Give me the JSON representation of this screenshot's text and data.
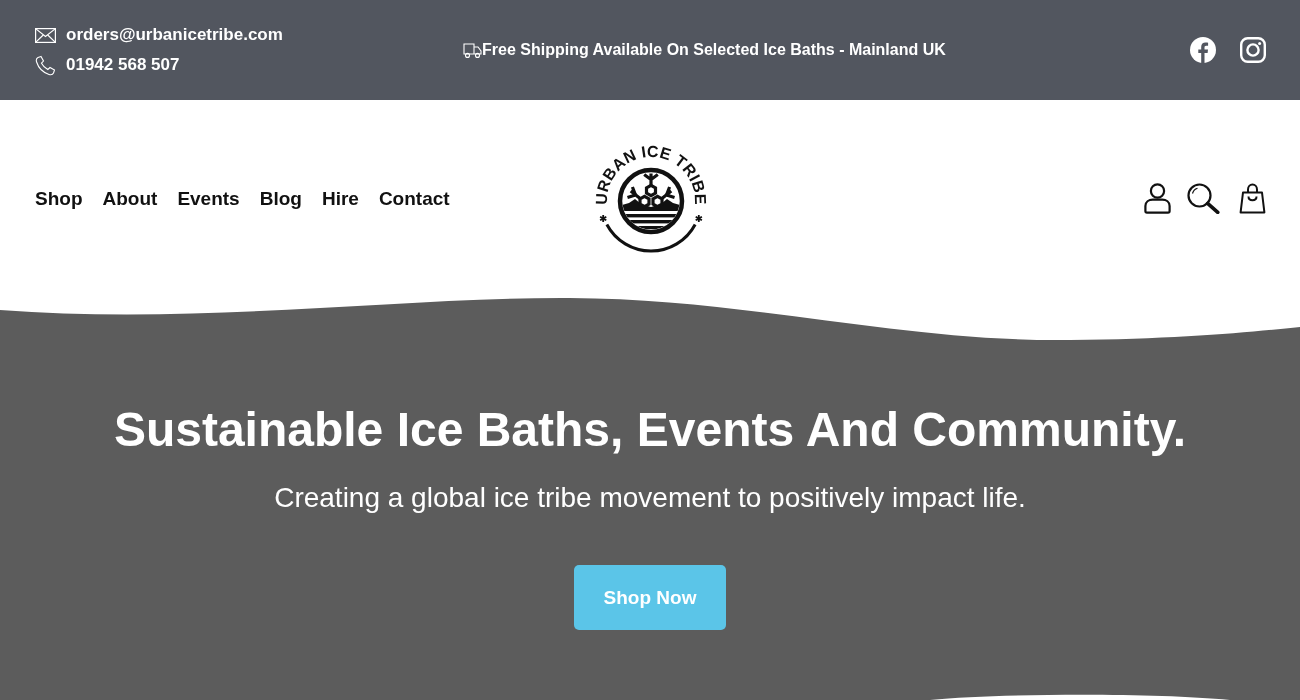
{
  "top_bar": {
    "email": "orders@urbanicetribe.com",
    "phone": "01942 568 507",
    "announcement": "Free Shipping Available On Selected Ice Baths - Mainland UK"
  },
  "header": {
    "nav": [
      "Shop",
      "About",
      "Events",
      "Blog",
      "Hire",
      "Contact"
    ],
    "logo": "URBAN ICE TRIBE"
  },
  "hero": {
    "title": "Sustainable Ice Baths, Events And Community.",
    "subtitle": "Creating a global ice tribe movement to positively impact life.",
    "button": "Shop Now"
  }
}
